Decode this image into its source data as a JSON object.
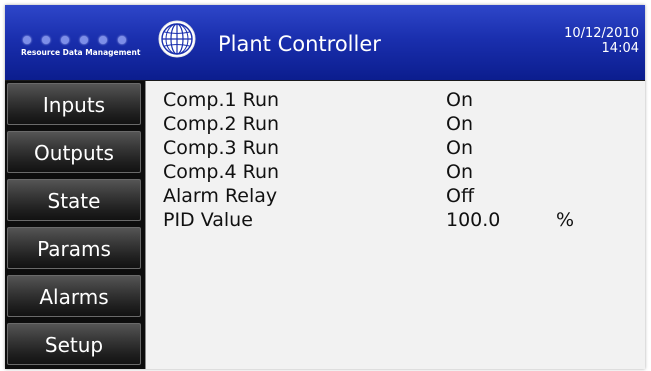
{
  "header": {
    "logo_text": "Resource Data Management",
    "title": "Plant Controller",
    "date": "10/12/2010",
    "time": "14:04",
    "accent_color": "#1a2fae"
  },
  "nav": [
    {
      "label": "Inputs"
    },
    {
      "label": "Outputs"
    },
    {
      "label": "State"
    },
    {
      "label": "Params"
    },
    {
      "label": "Alarms"
    },
    {
      "label": "Setup"
    }
  ],
  "rows": [
    {
      "label": "Comp.1 Run",
      "value": "On",
      "unit": ""
    },
    {
      "label": "Comp.2 Run",
      "value": "On",
      "unit": ""
    },
    {
      "label": "Comp.3 Run",
      "value": "On",
      "unit": ""
    },
    {
      "label": "Comp.4 Run",
      "value": "On",
      "unit": ""
    },
    {
      "label": "Alarm Relay",
      "value": "Off",
      "unit": ""
    },
    {
      "label": "PID Value",
      "value": "100.0",
      "unit": "%"
    }
  ]
}
